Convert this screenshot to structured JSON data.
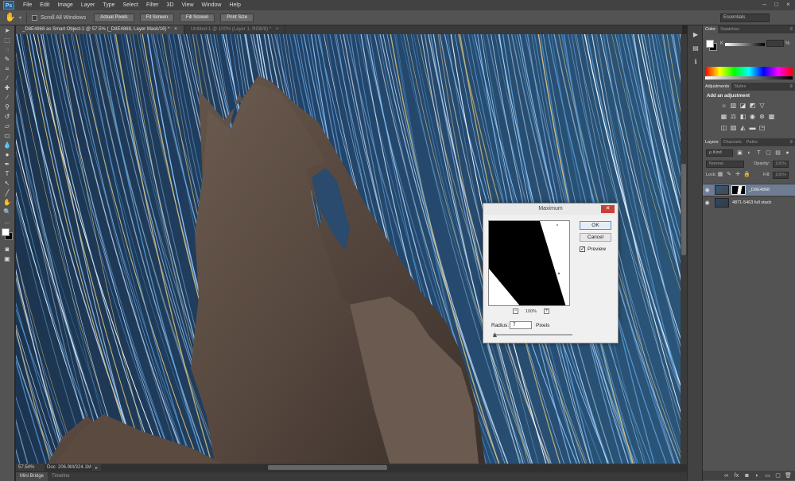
{
  "app": {
    "logo": "Ps",
    "menu": [
      "File",
      "Edit",
      "Image",
      "Layer",
      "Type",
      "Select",
      "Filter",
      "3D",
      "View",
      "Window",
      "Help"
    ],
    "window_controls": [
      "–",
      "□",
      "×"
    ]
  },
  "options_bar": {
    "tool_icon": "hand-icon",
    "scroll_all_windows": {
      "label": "Scroll All Windows",
      "checked": false
    },
    "buttons": [
      "Actual Pixels",
      "Fit Screen",
      "Fill Screen",
      "Print Size"
    ],
    "workspace": "Essentials"
  },
  "document_tabs": [
    {
      "label": "_D8E4868 as Smart Object-1 @ 57.5% (_D8E4868, Layer Mask/16) *",
      "active": true
    },
    {
      "label": "Untitled-1 @ 100% (Layer 1, RGB/8) *",
      "active": false
    }
  ],
  "status_bar": {
    "zoom": "57.54%",
    "doc_size": "Doc: 206.9M/324.1M"
  },
  "bottom_tabs": [
    "Mini Bridge",
    "Timeline"
  ],
  "color_panel": {
    "tabs": [
      "Color",
      "Swatches"
    ],
    "channel_label": "K",
    "percent": "%"
  },
  "adjustments_panel": {
    "tabs": [
      "Adjustments",
      "Styles"
    ],
    "title": "Add an adjustment"
  },
  "layers_panel": {
    "tabs": [
      "Layers",
      "Channels",
      "Paths"
    ],
    "kind_filter": "ρ Kind",
    "blend_mode": "Normal",
    "opacity_label": "Opacity:",
    "opacity_value": "100%",
    "lock_label": "Lock:",
    "fill_label": "Fill:",
    "fill_value": "100%",
    "layers": [
      {
        "name": "_D8E4868",
        "selected": true,
        "has_mask": true
      },
      {
        "name": "4871-5463 full stack",
        "selected": false,
        "has_mask": false
      }
    ]
  },
  "dialog": {
    "title": "Maximum",
    "ok_label": "OK",
    "cancel_label": "Cancel",
    "preview_label": "Preview",
    "preview_checked": true,
    "zoom_label": "100%",
    "radius_label": "Radius:",
    "radius_value": "7",
    "radius_unit": "Pixels"
  }
}
